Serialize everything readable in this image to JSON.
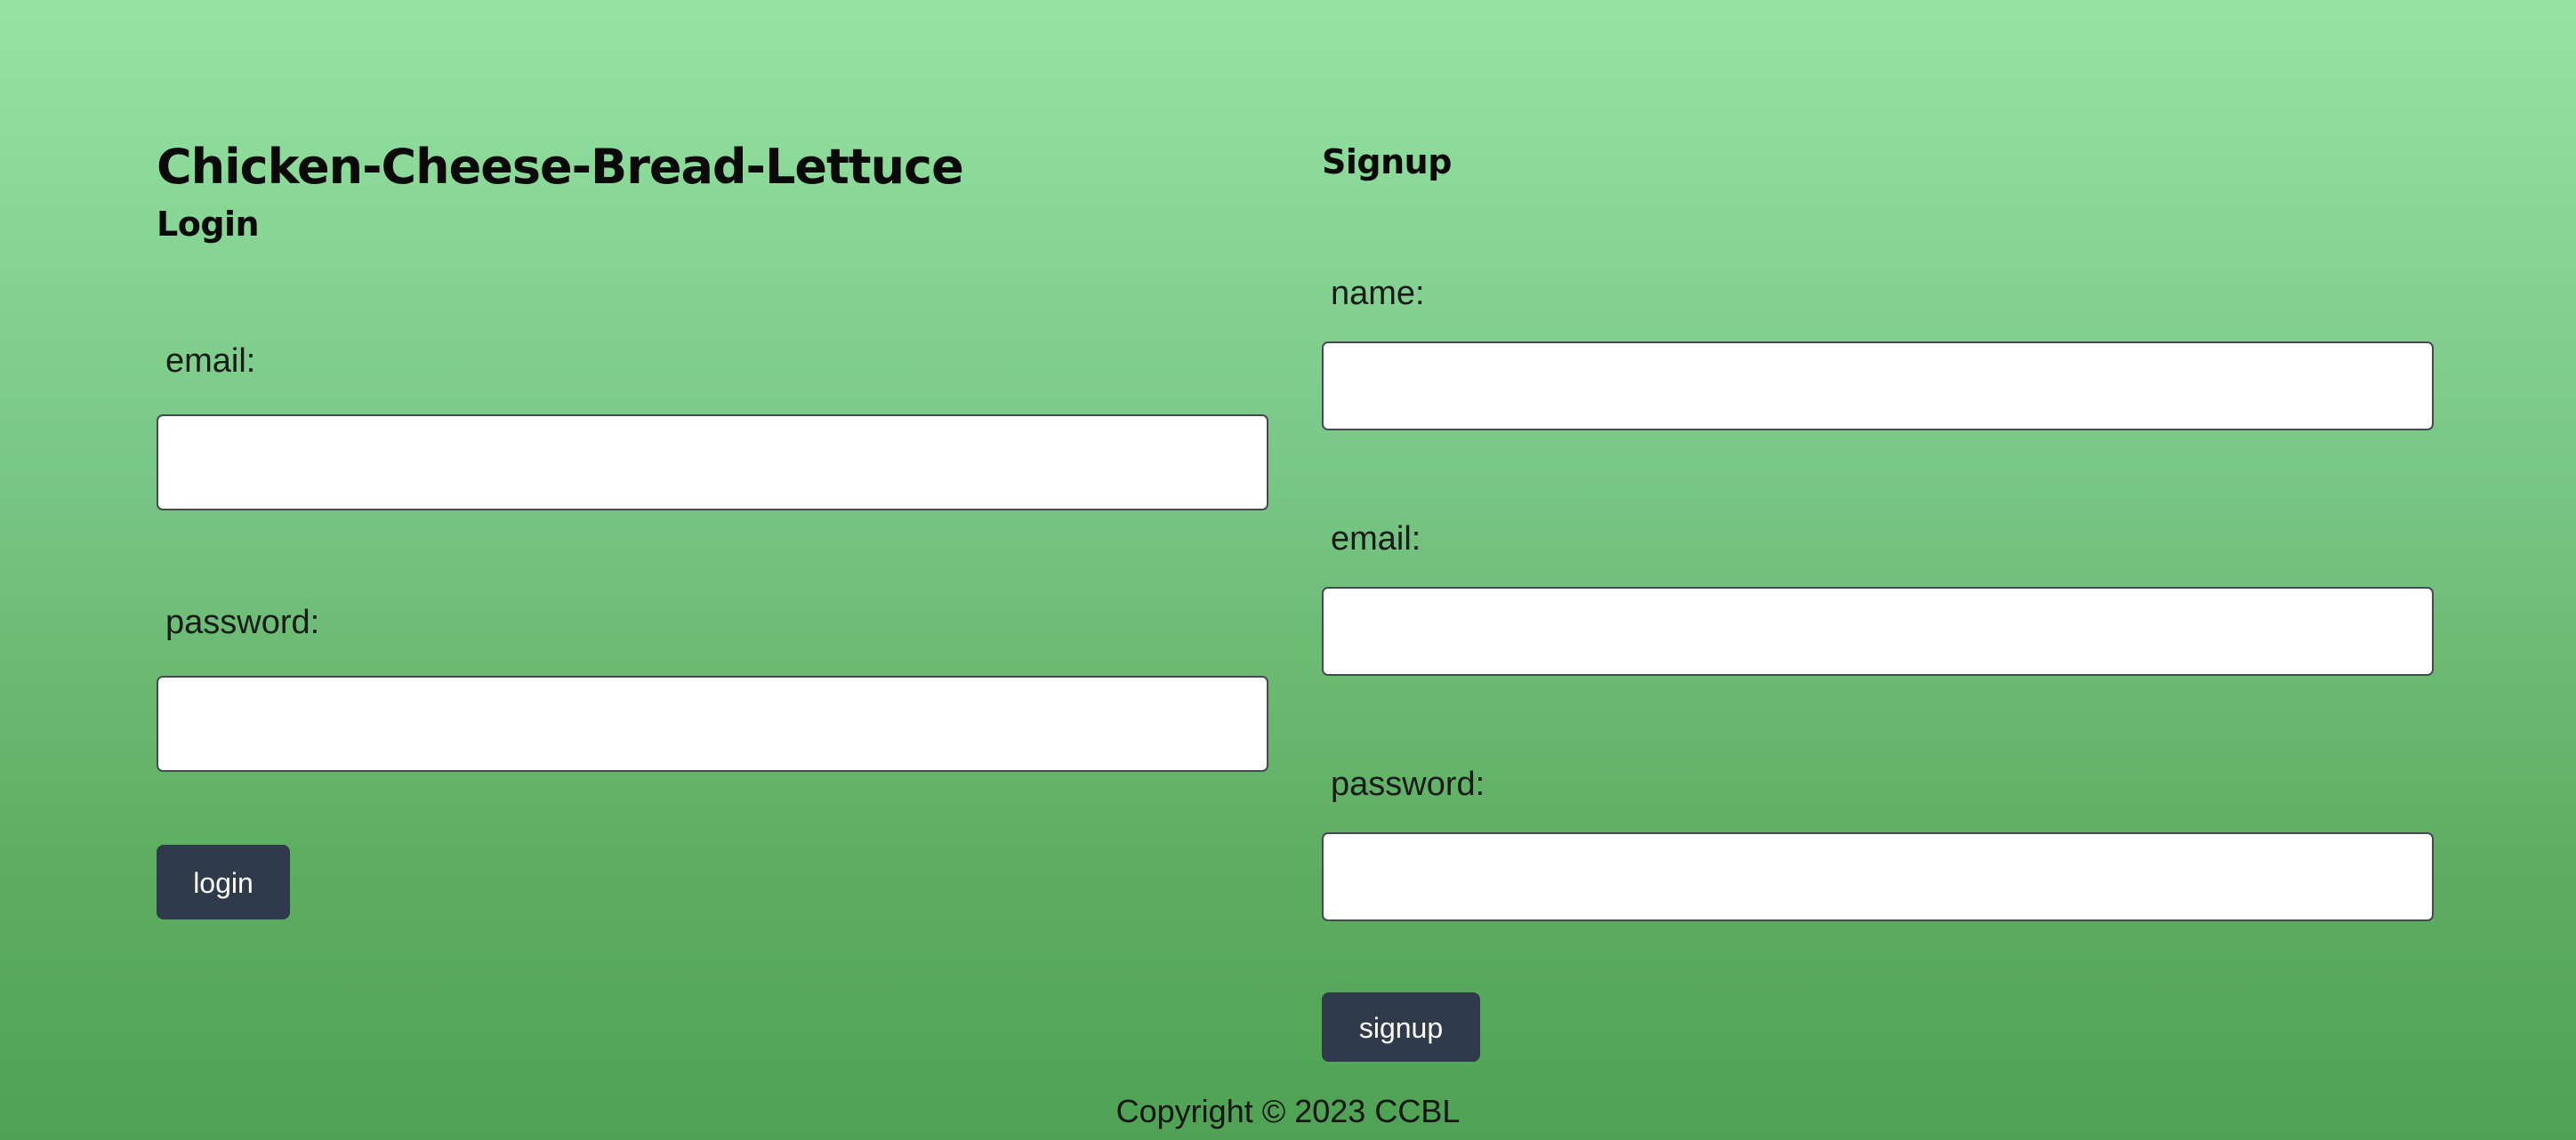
{
  "site": {
    "title": "Chicken-Cheese-Bread-Lettuce"
  },
  "login": {
    "heading": "Login",
    "email_label": "email:",
    "password_label": "password:",
    "button_label": "login"
  },
  "signup": {
    "heading": "Signup",
    "name_label": "name:",
    "email_label": "email:",
    "password_label": "password:",
    "button_label": "signup"
  },
  "footer": {
    "copyright": "Copyright © 2023 CCBL"
  },
  "colors": {
    "background_top": "#96e4a3",
    "background_bottom": "#4fa253",
    "button": "#2f3a4b"
  }
}
